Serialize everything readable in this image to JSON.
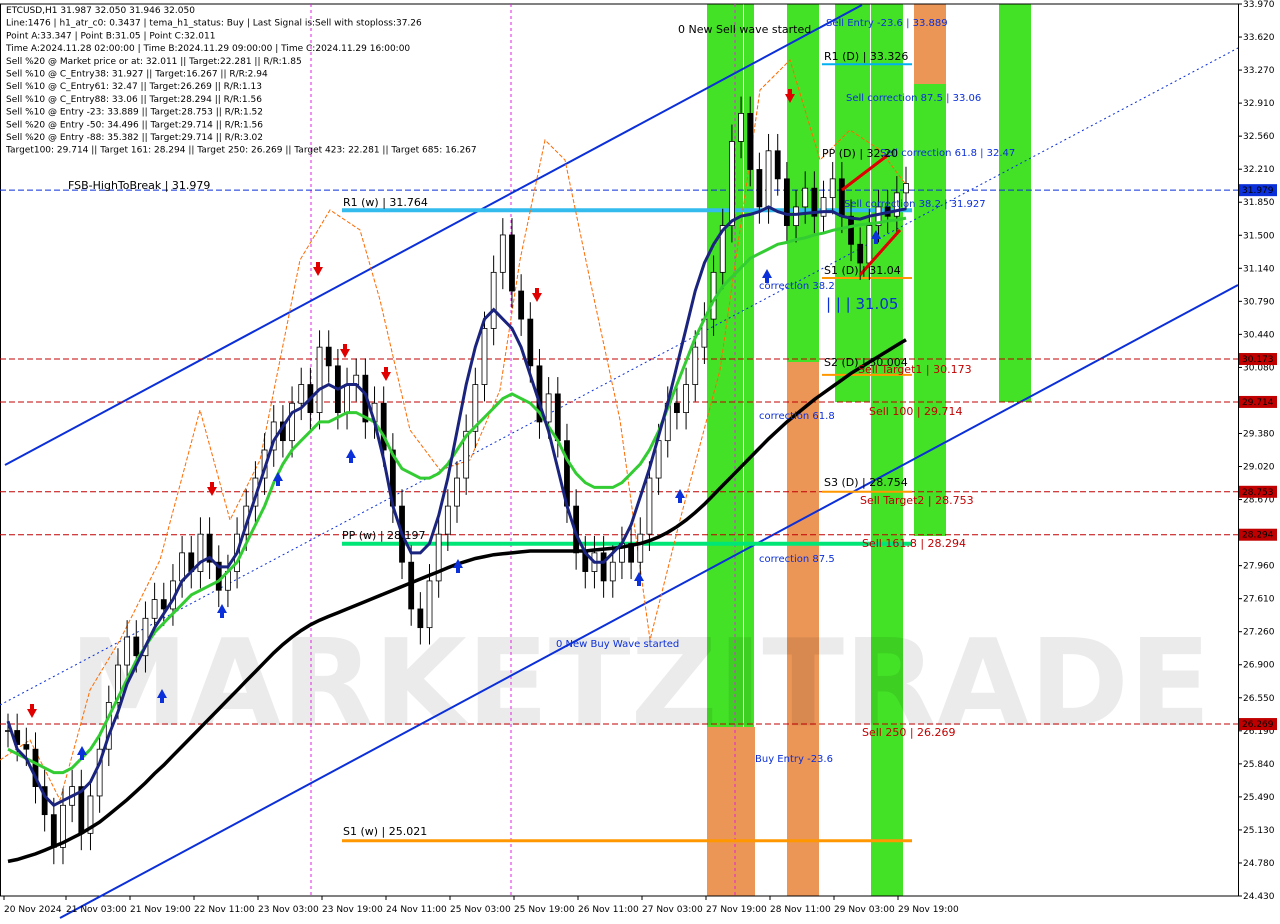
{
  "info": {
    "lines": [
      "ETCUSD,H1  31.987 32.050 31.946 32.050",
      "Line:1476 | h1_atr_c0: 0.3437 | tema_h1_status: Buy | Last Signal is:Sell with stoploss:37.26",
      "Point A:33.347 | Point B:31.05 | Point C:32.011",
      "Time A:2024.11.28 02:00:00 | Time B:2024.11.29 09:00:00 | Time C:2024.11.29 16:00:00",
      "Sell %20 @ Market price or at: 32.011 || Target:22.281 || R/R:1.85",
      "Sell %10 @ C_Entry38: 31.927 || Target:16.267 || R/R:2.94",
      "Sell %10 @ C_Entry61: 32.47 || Target:26.269 || R/R:1.13",
      "Sell %10 @ C_Entry88: 33.06 || Target:28.294 || R/R:1.56",
      "Sell %10 @ Entry -23: 33.889 || Target:28.753 || R/R:1.52",
      "Sell %20 @ Entry -50: 34.496 || Target:29.714 || R/R:1.56",
      "Sell %20 @ Entry -88: 35.382 || Target:29.714 || R/R:3.02",
      "Target100: 29.714 || Target 161: 28.294 || Target 250: 26.269 || Target 423: 22.281 || Target 685: 16.267"
    ]
  },
  "chart_data": {
    "type": "candlestick",
    "symbol": "ETCUSD",
    "timeframe": "H1",
    "ylim": [
      24.43,
      33.97
    ],
    "y_ticks": [
      "33.970",
      "33.620",
      "33.270",
      "32.910",
      "32.560",
      "32.210",
      "31.850",
      "31.500",
      "31.140",
      "30.790",
      "30.440",
      "30.080",
      "29.730",
      "29.380",
      "29.020",
      "28.670",
      "28.320",
      "27.960",
      "27.610",
      "27.260",
      "26.900",
      "26.550",
      "26.190",
      "25.840",
      "25.490",
      "25.130",
      "24.780",
      "24.430"
    ],
    "x_ticks": [
      "20 Nov 2024",
      "21 Nov 03:00",
      "21 Nov 19:00",
      "22 Nov 11:00",
      "23 Nov 03:00",
      "23 Nov 19:00",
      "24 Nov 11:00",
      "25 Nov 03:00",
      "25 Nov 19:00",
      "26 Nov 11:00",
      "27 Nov 03:00",
      "27 Nov 19:00",
      "28 Nov 11:00",
      "29 Nov 03:00",
      "29 Nov 19:00"
    ],
    "current_price": "31.979",
    "axis_badges": [
      {
        "value": "30.173",
        "color": "#c00000"
      },
      {
        "value": "29.714",
        "color": "#c00000"
      },
      {
        "value": "28.753",
        "color": "#c00000"
      },
      {
        "value": "28.294",
        "color": "#c00000"
      },
      {
        "value": "26.269",
        "color": "#c00000"
      },
      {
        "value": "31.979",
        "color": "#0b2fd8"
      }
    ],
    "levels": [
      {
        "label": "Sell Entry -23.6 | 33.889",
        "value": 33.889,
        "color": "#1565c0"
      },
      {
        "label": "R1 (D) | 33.326",
        "value": 33.326,
        "color": "#00b0f0"
      },
      {
        "label": "Sell correction 87.5 | 33.06",
        "value": 33.06,
        "color": "#1565c0"
      },
      {
        "label": "Sell correction 61.8 | 32.47",
        "value": 32.47,
        "color": "#1565c0"
      },
      {
        "label": "FSB-HighToBreak | 31.979",
        "value": 31.979,
        "color": "#000"
      },
      {
        "label": "Sell correction 38.2 | 31.927",
        "value": 31.927,
        "color": "#1565c0"
      },
      {
        "label": "R1 (w) | 31.764",
        "value": 31.764,
        "color": "#00b0f0"
      },
      {
        "label": "S1 (D) | 31.04",
        "value": 31.04,
        "color": "#ff9800"
      },
      {
        "label": "S2 (D) | 30.004",
        "value": 30.004,
        "color": "#ff9800"
      },
      {
        "label": "Sell Target1 | 30.173",
        "value": 30.173,
        "color": "#c00000"
      },
      {
        "label": "Sell 100 | 29.714",
        "value": 29.714,
        "color": "#c00000"
      },
      {
        "label": "S3 (D) | 28.754",
        "value": 28.754,
        "color": "#ff9800"
      },
      {
        "label": "Sell Target2 | 28.753",
        "value": 28.753,
        "color": "#c00000"
      },
      {
        "label": "PP (w) | 28.197",
        "value": 28.197,
        "color": "#00e676"
      },
      {
        "label": "Sell 161.8 | 28.294",
        "value": 28.294,
        "color": "#c00000"
      },
      {
        "label": "Sell 250 | 26.269",
        "value": 26.269,
        "color": "#c00000"
      },
      {
        "label": "S1 (w) | 25.021",
        "value": 25.021,
        "color": "#ff9800"
      }
    ],
    "annotations": {
      "sell_wave": "0 New Sell wave started",
      "buy_wave": "0 New Buy Wave started",
      "correction_382": "correction 38.2",
      "correction_618": "correction 61.8",
      "correction_875": "correction 87.5",
      "buy_entry": "Buy Entry -23.6",
      "wave_count": "| | | 31.05",
      "pp_d": "PP (D) | 32.20",
      "watermark": "MARKETZITRADE"
    },
    "series": [
      {
        "name": "close",
        "values": [
          26.2,
          26.05,
          26.0,
          25.6,
          25.3,
          24.95,
          25.4,
          25.6,
          25.1,
          25.5,
          26.0,
          26.5,
          26.9,
          27.2,
          27.0,
          27.4,
          27.6,
          27.5,
          27.8,
          28.1,
          27.9,
          28.3,
          28.0,
          27.7,
          27.9,
          28.3,
          28.6,
          28.9,
          29.2,
          29.5,
          29.3,
          29.7,
          29.9,
          29.6,
          30.3,
          30.1,
          29.6,
          29.9,
          30.0,
          29.5,
          29.7,
          29.2,
          28.6,
          28.0,
          27.5,
          27.3,
          27.8,
          28.3,
          28.6,
          28.9,
          29.4,
          29.9,
          30.5,
          31.1,
          31.5,
          30.9,
          30.6,
          30.1,
          29.5,
          29.8,
          29.3,
          28.6,
          28.1,
          27.9,
          28.1,
          27.8,
          28.0,
          28.2,
          28.0,
          28.3,
          28.9,
          29.3,
          29.7,
          29.6,
          29.9,
          30.3,
          30.6,
          31.1,
          31.6,
          32.5,
          32.8,
          32.2,
          31.8,
          32.4,
          32.1,
          31.6,
          31.8,
          32.0,
          31.7,
          31.9,
          32.1,
          31.7,
          31.4,
          31.2,
          31.6,
          31.8,
          31.7,
          31.95,
          32.05
        ]
      },
      {
        "name": "ema_blue",
        "values": [
          26.3,
          26.0,
          25.9,
          25.7,
          25.5,
          25.4,
          25.45,
          25.5,
          25.55,
          25.65,
          25.85,
          26.15,
          26.4,
          26.7,
          26.9,
          27.1,
          27.3,
          27.45,
          27.6,
          27.8,
          27.9,
          28.0,
          28.05,
          27.95,
          27.95,
          28.1,
          28.4,
          28.7,
          29.0,
          29.3,
          29.45,
          29.6,
          29.65,
          29.75,
          29.85,
          29.9,
          29.85,
          29.9,
          29.9,
          29.8,
          29.5,
          29.1,
          28.6,
          28.3,
          28.1,
          28.1,
          28.2,
          28.5,
          28.9,
          29.4,
          29.9,
          30.3,
          30.6,
          30.7,
          30.6,
          30.5,
          30.3,
          30.0,
          29.7,
          29.4,
          29.0,
          28.6,
          28.3,
          28.1,
          28.0,
          28.0,
          28.1,
          28.2,
          28.4,
          28.7,
          29.0,
          29.35,
          29.7,
          30.1,
          30.5,
          30.9,
          31.2,
          31.4,
          31.55,
          31.65,
          31.7,
          31.72,
          31.75,
          31.8,
          31.75,
          31.72,
          31.72,
          31.73,
          31.74,
          31.75,
          31.75,
          31.7,
          31.68,
          31.67,
          31.7,
          31.72,
          31.74,
          31.76,
          31.78
        ]
      },
      {
        "name": "ma_green",
        "values": [
          26.0,
          25.95,
          25.9,
          25.85,
          25.8,
          25.75,
          25.75,
          25.8,
          25.9,
          26.0,
          26.15,
          26.35,
          26.55,
          26.75,
          26.95,
          27.1,
          27.25,
          27.35,
          27.45,
          27.55,
          27.65,
          27.7,
          27.75,
          27.8,
          27.9,
          28.0,
          28.2,
          28.4,
          28.6,
          28.85,
          29.05,
          29.2,
          29.3,
          29.4,
          29.5,
          29.5,
          29.55,
          29.6,
          29.6,
          29.55,
          29.5,
          29.35,
          29.15,
          29.0,
          28.95,
          28.9,
          28.9,
          28.95,
          29.05,
          29.2,
          29.35,
          29.45,
          29.55,
          29.65,
          29.75,
          29.8,
          29.75,
          29.7,
          29.6,
          29.45,
          29.3,
          29.1,
          28.95,
          28.85,
          28.8,
          28.8,
          28.8,
          28.85,
          28.95,
          29.05,
          29.2,
          29.4,
          29.65,
          29.9,
          30.15,
          30.4,
          30.6,
          30.8,
          30.95,
          31.05,
          31.15,
          31.25,
          31.3,
          31.35,
          31.4,
          31.42,
          31.45,
          31.47,
          31.5,
          31.52,
          31.55,
          31.57,
          31.59,
          31.61,
          31.62,
          31.63,
          31.65,
          31.66,
          31.68
        ]
      },
      {
        "name": "ma_black",
        "values": [
          24.8,
          24.82,
          24.85,
          24.88,
          24.92,
          24.96,
          25.0,
          25.05,
          25.1,
          25.16,
          25.22,
          25.3,
          25.38,
          25.46,
          25.55,
          25.64,
          25.74,
          25.83,
          25.93,
          26.03,
          26.13,
          26.23,
          26.33,
          26.43,
          26.53,
          26.63,
          26.73,
          26.83,
          26.93,
          27.03,
          27.12,
          27.2,
          27.27,
          27.33,
          27.38,
          27.42,
          27.46,
          27.5,
          27.54,
          27.58,
          27.62,
          27.66,
          27.7,
          27.74,
          27.78,
          27.82,
          27.86,
          27.9,
          27.94,
          27.98,
          28.01,
          28.04,
          28.06,
          28.08,
          28.09,
          28.1,
          28.11,
          28.12,
          28.12,
          28.12,
          28.12,
          28.12,
          28.12,
          28.12,
          28.13,
          28.14,
          28.15,
          28.16,
          28.18,
          28.2,
          28.23,
          28.27,
          28.32,
          28.38,
          28.45,
          28.53,
          28.62,
          28.72,
          28.82,
          28.92,
          29.02,
          29.12,
          29.22,
          29.32,
          29.41,
          29.5,
          29.58,
          29.66,
          29.74,
          29.81,
          29.88,
          29.95,
          30.02,
          30.08,
          30.14,
          30.2,
          30.26,
          30.32,
          30.38
        ]
      }
    ]
  }
}
